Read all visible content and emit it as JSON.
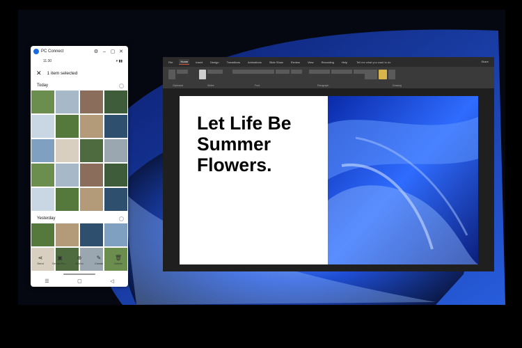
{
  "phone": {
    "title": "PC Connect",
    "time": "11:30",
    "selection": "1 item selected",
    "sections": [
      {
        "label": "Today",
        "tiles": 20
      },
      {
        "label": "Yesterday",
        "tiles": 8
      }
    ],
    "actions": [
      {
        "label": "Send",
        "icon": "share-icon"
      },
      {
        "label": "Set as Pro...",
        "icon": "image-icon"
      },
      {
        "label": "Add to",
        "icon": "add-icon"
      },
      {
        "label": "Create",
        "icon": "edit-icon"
      },
      {
        "label": "Delete",
        "icon": "trash-icon"
      }
    ]
  },
  "ppt": {
    "tabs": [
      "File",
      "Home",
      "Insert",
      "Design",
      "Transitions",
      "Animations",
      "Slide Show",
      "Review",
      "View",
      "Recording",
      "Help"
    ],
    "active_tab": "Home",
    "tell_me": "Tell me what you want to do",
    "share": "Share",
    "ribbon_groups": [
      "Clipboard",
      "Slides",
      "Font",
      "Paragraph",
      "Drawing"
    ],
    "new_slide": "New Slide",
    "section": "Section",
    "arrange": "Arrange"
  },
  "slide": {
    "lines": [
      "Let Life Be",
      "Summer",
      "Flowers."
    ]
  },
  "colors": {
    "accent": "#1a6be0",
    "ppt_accent": "#d35230",
    "slide_bg": "#ffffff",
    "ribbon": "#3a3a3a"
  }
}
